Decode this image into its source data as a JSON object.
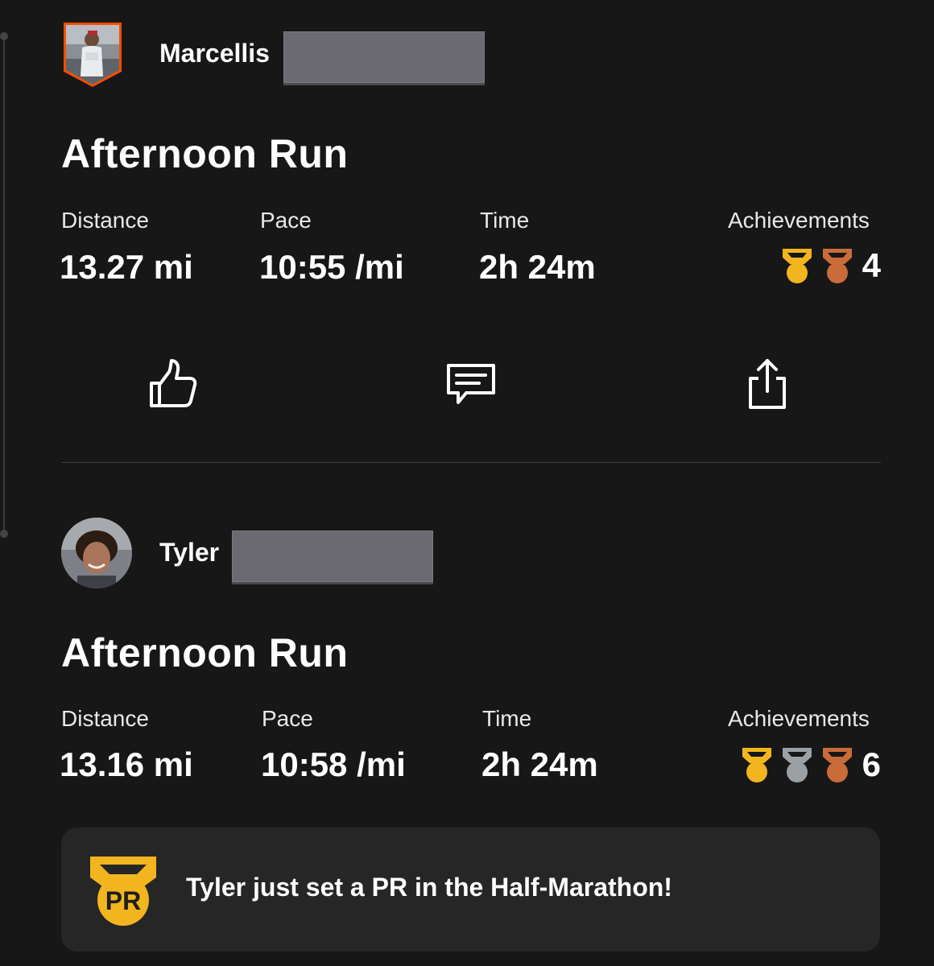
{
  "feed": [
    {
      "athlete": {
        "first_name": "Marcellis",
        "avatar_style": "shield"
      },
      "activity_title": "Afternoon Run",
      "stats": {
        "distance_label": "Distance",
        "distance_value": "13.27 mi",
        "pace_label": "Pace",
        "pace_value": "10:55 /mi",
        "time_label": "Time",
        "time_value": "2h 24m",
        "achievements_label": "Achievements",
        "achievements_count": "4",
        "medals": [
          "gold",
          "bronze"
        ]
      },
      "actions": [
        "thumbs-up-icon",
        "comment-icon",
        "share-icon"
      ]
    },
    {
      "athlete": {
        "first_name": "Tyler",
        "avatar_style": "circle"
      },
      "activity_title": "Afternoon Run",
      "stats": {
        "distance_label": "Distance",
        "distance_value": "13.16 mi",
        "pace_label": "Pace",
        "pace_value": "10:58 /mi",
        "time_label": "Time",
        "time_value": "2h 24m",
        "achievements_label": "Achievements",
        "achievements_count": "6",
        "medals": [
          "gold",
          "silver",
          "bronze"
        ]
      },
      "pr_banner": {
        "badge_text": "PR",
        "message": "Tyler just set a PR in the Half-Marathon!"
      }
    }
  ],
  "colors": {
    "background": "#171717",
    "gold": "#f2b51f",
    "silver": "#9aa0a3",
    "bronze": "#c96c3a",
    "brand_orange": "#fc4c02"
  }
}
